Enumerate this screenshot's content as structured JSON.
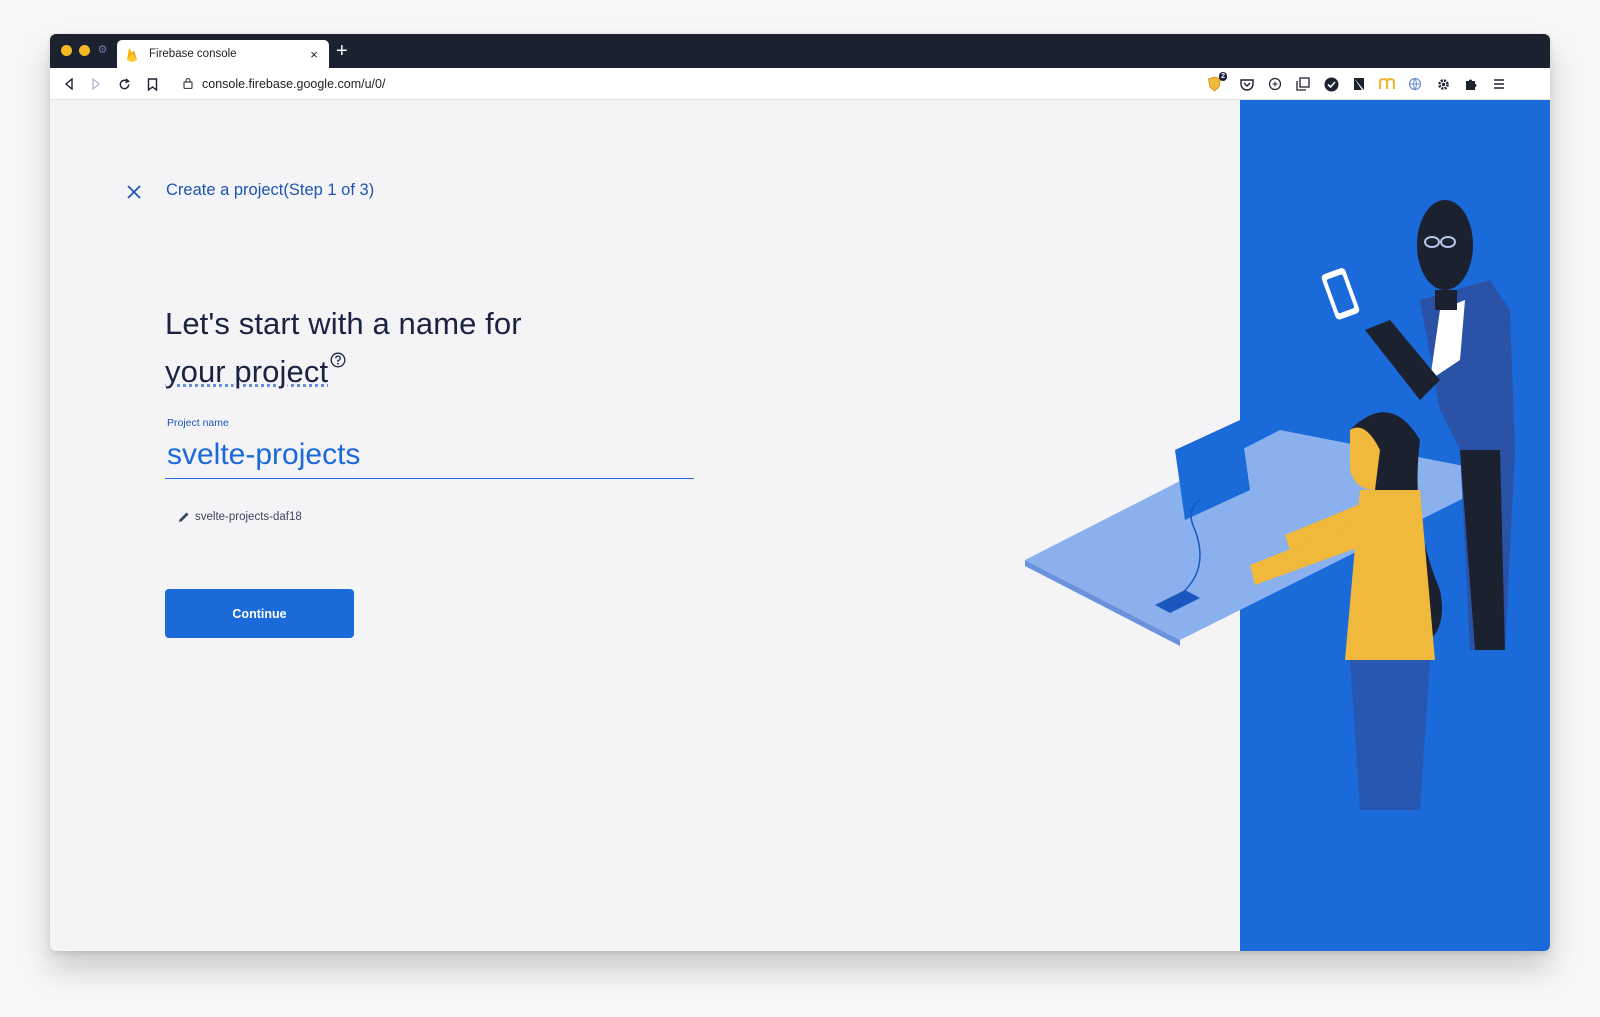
{
  "browser": {
    "tab_title": "Firebase console",
    "tab_close": "×",
    "new_tab": "+",
    "url": "console.firebase.google.com/u/0/",
    "extension_badge": "2"
  },
  "page": {
    "step_label": "Create a project(Step 1 of 3)",
    "heading_line1": "Let's start with a name for",
    "heading_line2": "your project",
    "field_label": "Project name",
    "project_name_value": "svelte-projects",
    "project_id": "svelte-projects-daf18",
    "continue_label": "Continue"
  },
  "colors": {
    "accent": "#1a6ad9",
    "tab_bar": "#1c2130",
    "illustration_yellow": "#f0b93c",
    "illustration_light_blue": "#8ab0ee"
  }
}
